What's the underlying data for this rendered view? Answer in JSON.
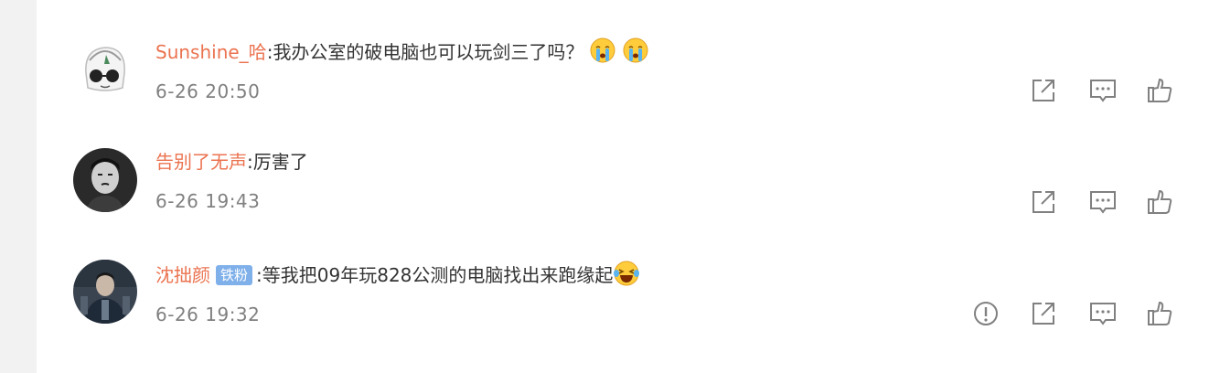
{
  "comments": [
    {
      "username": "Sunshine_哈",
      "separator": ":",
      "badge": "",
      "text": "我办公室的破电脑也可以玩剑三了吗？",
      "emojis": [
        "crying-emoji",
        "crying-emoji"
      ],
      "time": "6-26 20:50",
      "actions": [
        "share-icon",
        "comment-icon",
        "like-icon"
      ]
    },
    {
      "username": "告别了无声",
      "separator": ":",
      "badge": "",
      "text": "厉害了",
      "emojis": [],
      "time": "6-26 19:43",
      "actions": [
        "share-icon",
        "comment-icon",
        "like-icon"
      ]
    },
    {
      "username": "沈拙颜",
      "separator": ":",
      "badge": "铁粉",
      "text": "等我把09年玩828公测的电脑找出来跑缘起",
      "emojis": [
        "laughing-tears-emoji"
      ],
      "time": "6-26 19:32",
      "actions": [
        "report-icon",
        "share-icon",
        "comment-icon",
        "like-icon"
      ]
    }
  ],
  "colors": {
    "username": "#eb7350",
    "text": "#333333",
    "time": "#808080",
    "badge": "#7fb0ea",
    "icon": "#808080"
  }
}
